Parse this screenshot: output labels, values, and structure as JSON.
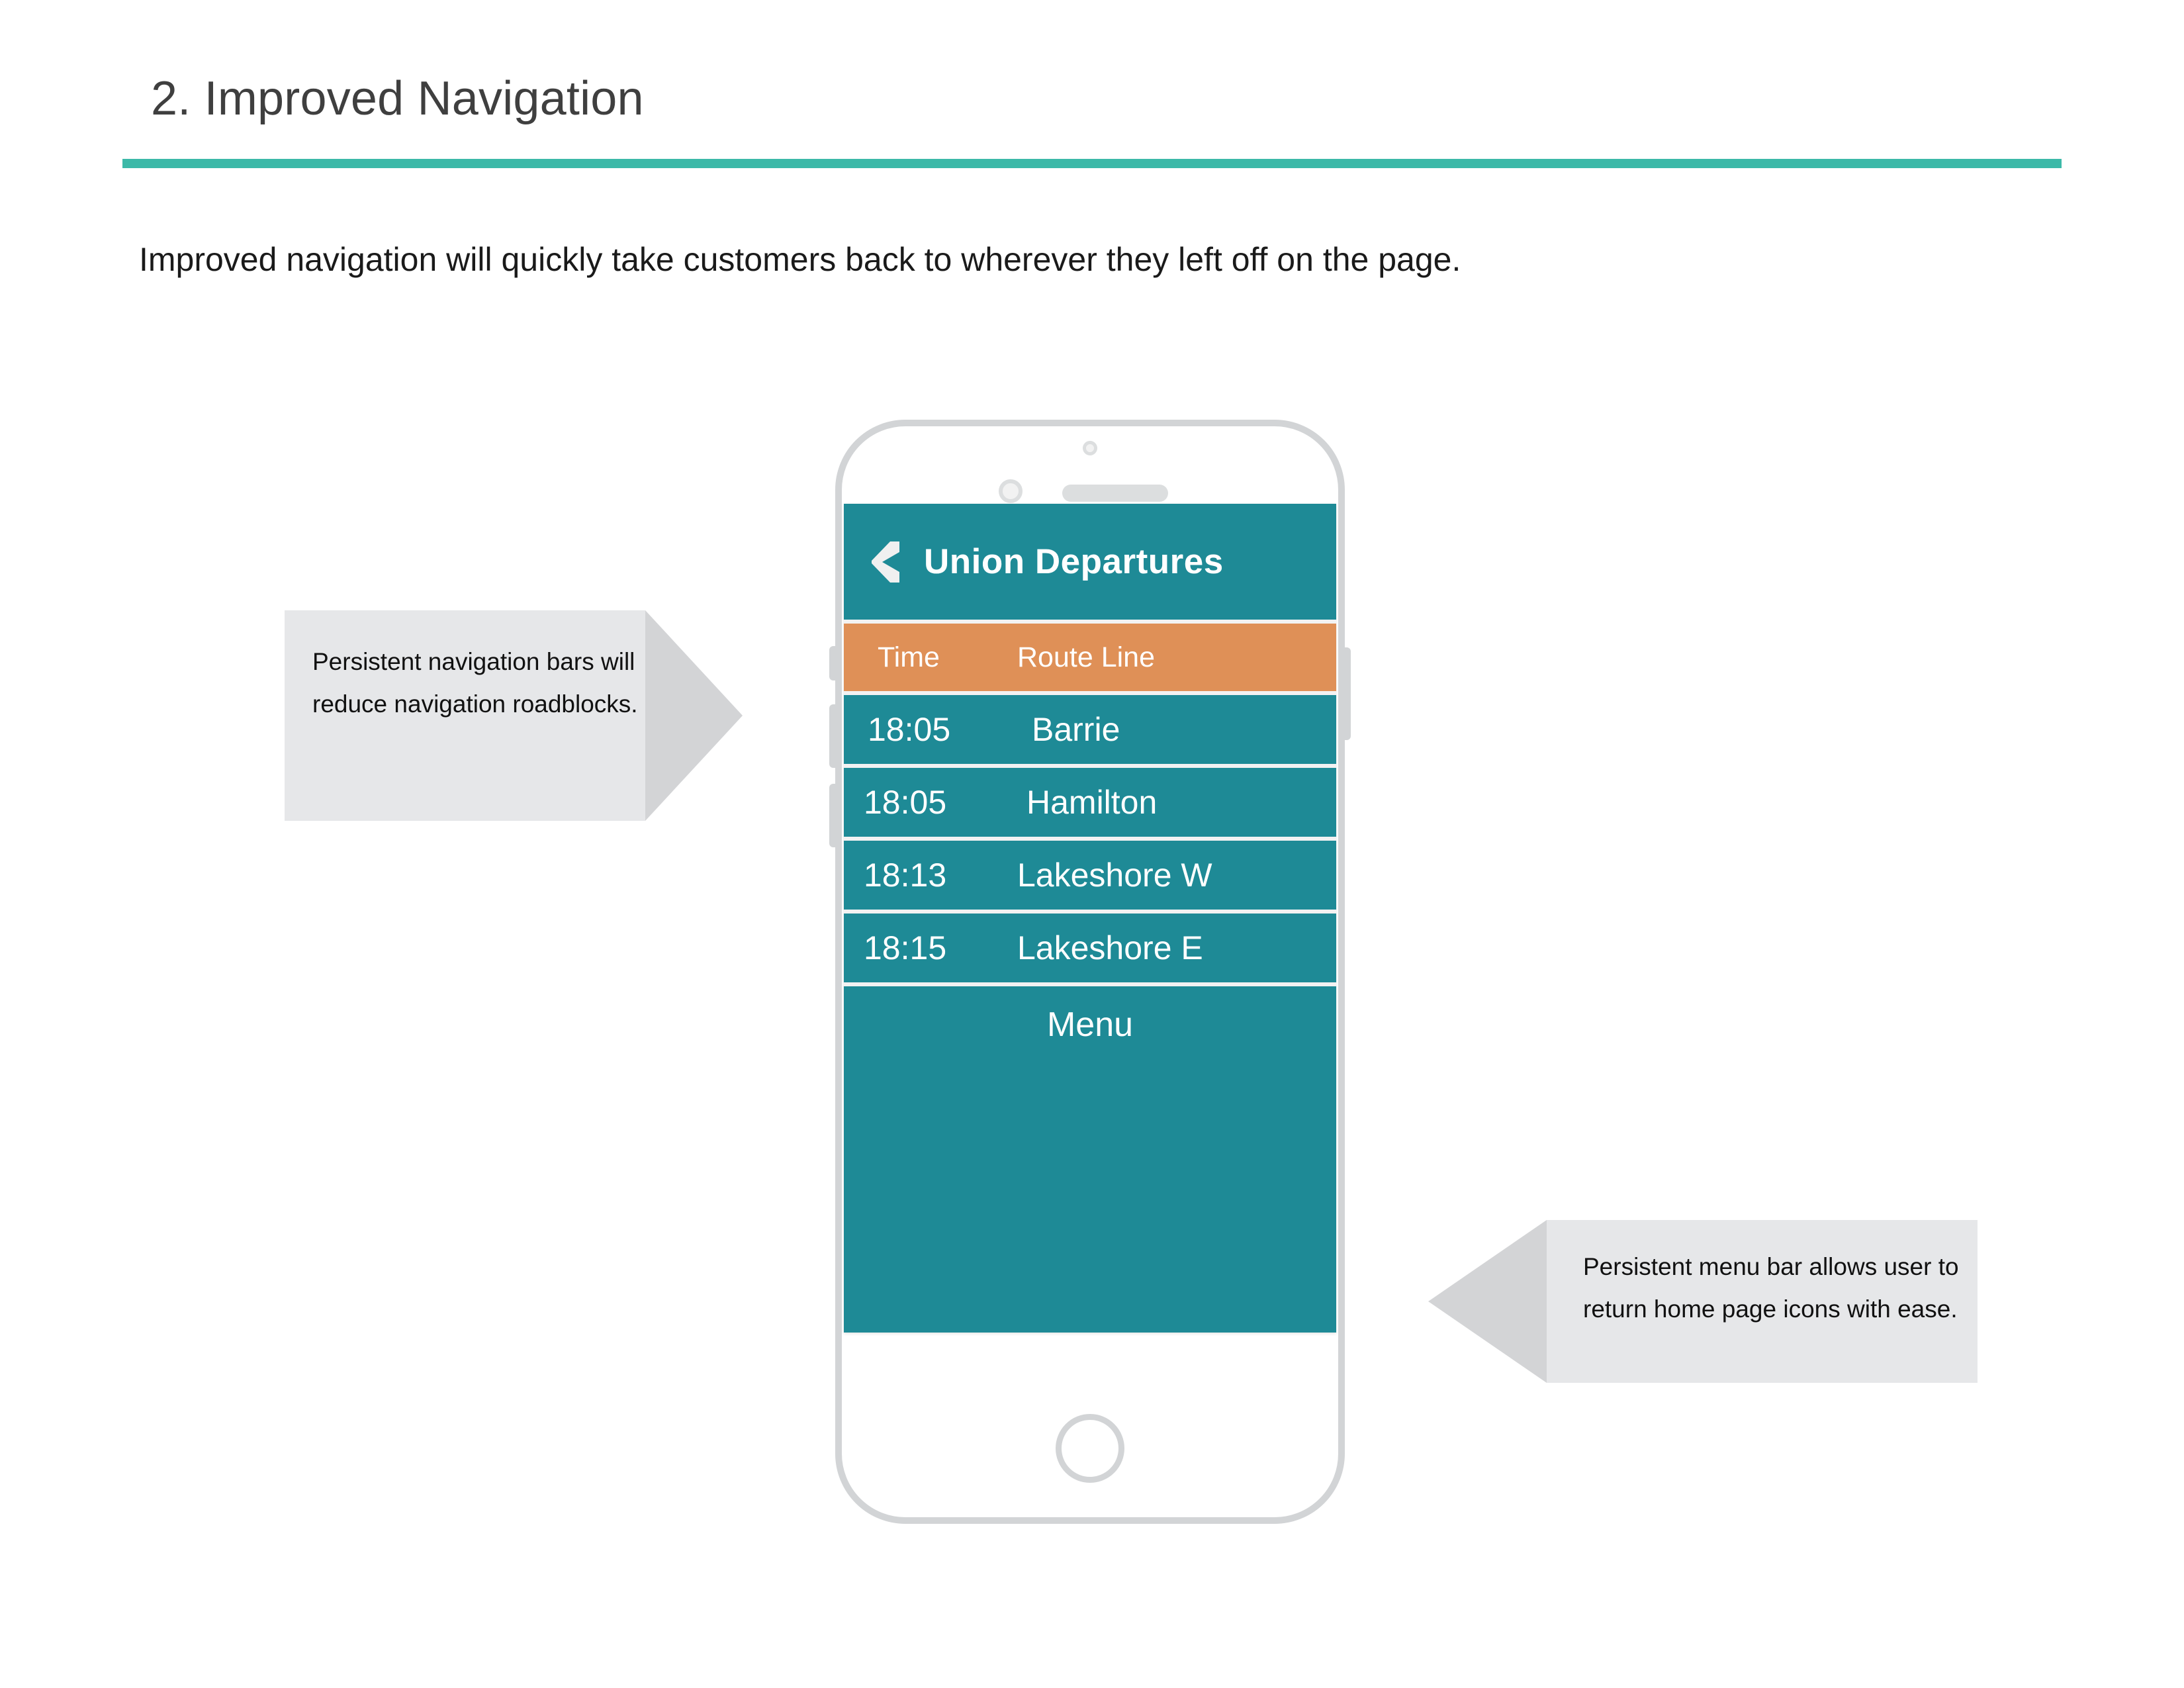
{
  "slide": {
    "title": "2. Improved Navigation",
    "subtitle": "Improved navigation will quickly take customers back to wherever they left off on the page.",
    "accent_color": "#3cb9a8",
    "title_color": "#3f3f3f"
  },
  "phone": {
    "icons": {
      "front_camera": "camera-icon",
      "top_camera": "sensor-icon",
      "speaker": "speaker-grille-icon",
      "home_button": "home-button-icon",
      "silent_switch": "silent-switch-icon",
      "volume_up": "volume-up-button-icon",
      "volume_down": "volume-down-button-icon",
      "power": "power-button-icon"
    },
    "screen": {
      "nav_bar": {
        "back_icon": "back-chevron-icon",
        "title": "Union Departures",
        "background": "#1e8a96",
        "text_color": "#ffffff"
      },
      "table": {
        "header_background": "#df9057",
        "row_background": "#1e8a96",
        "columns": [
          "Time",
          "Route Line"
        ],
        "rows": [
          {
            "time": "18:05",
            "route": "Barrie"
          },
          {
            "time": "18:05",
            "route": "Hamilton"
          },
          {
            "time": "18:13",
            "route": "Lakeshore W"
          },
          {
            "time": "18:15",
            "route": "Lakeshore E"
          }
        ]
      },
      "menu_bar": {
        "label": "Menu",
        "background": "#1e8a96"
      }
    }
  },
  "callouts": {
    "left": {
      "text": "Persistent navigation bars will reduce navigation roadblocks.",
      "body_color": "#e6e7e9",
      "arrow_color": "#d3d4d6",
      "direction": "right"
    },
    "right": {
      "text": "Persistent menu bar allows user to return home page icons with ease.",
      "body_color": "#e6e7e9",
      "arrow_color": "#d3d4d6",
      "direction": "left"
    }
  }
}
